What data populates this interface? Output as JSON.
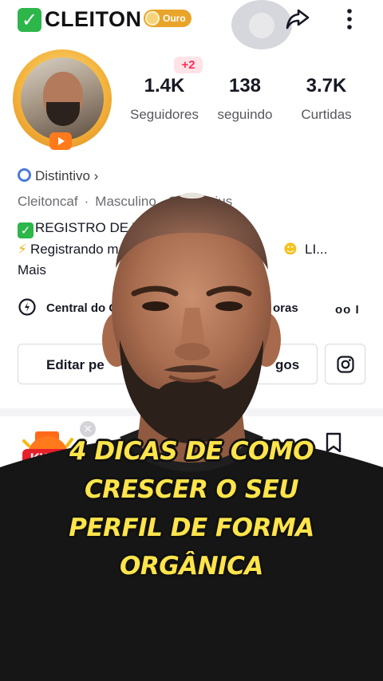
{
  "header": {
    "name": "CLEITON",
    "badge": "Ouro",
    "verified_glyph": "✓"
  },
  "stats": {
    "new_followers": "+2",
    "followers_count": "1.4K",
    "followers_label": "Seguidores",
    "following_count": "138",
    "following_label": "seguindo",
    "likes_count": "3.7K",
    "likes_label": "Curtidas"
  },
  "profile": {
    "badge_link": "Distintivo ›",
    "username": "Cleitoncaf",
    "separator": "·",
    "meta_visible": "Masculino · Sagittarius",
    "bio_line1": "REGISTRO DE VI",
    "bio_line2_start": "Registrando m",
    "bio_line2_end": "LI...",
    "more": "Mais"
  },
  "quick_actions": {
    "center_label": "Central do C",
    "right_label": "oras",
    "eyes_label": "oo  I"
  },
  "buttons": {
    "edit_left": "Editar pe",
    "edit_right": "gos"
  },
  "promo": {
    "label": "KWAI"
  },
  "caption": {
    "line1": "4 DICAS DE COMO",
    "line2": "CRESCER O SEU",
    "line3": "PERFIL DE FORMA",
    "line4": "ORGÂNICA"
  },
  "icons": {
    "share": "share-icon",
    "more": "more-vertical-icon",
    "instagram": "instagram-icon",
    "bookmark": "bookmark-icon",
    "clock": "clock-icon"
  },
  "colors": {
    "caption_fill": "#ffe44a",
    "caption_outline": "#111111",
    "accent_red": "#fe2c55",
    "verified_green": "#2db64a",
    "gold": "#e9a42a"
  }
}
